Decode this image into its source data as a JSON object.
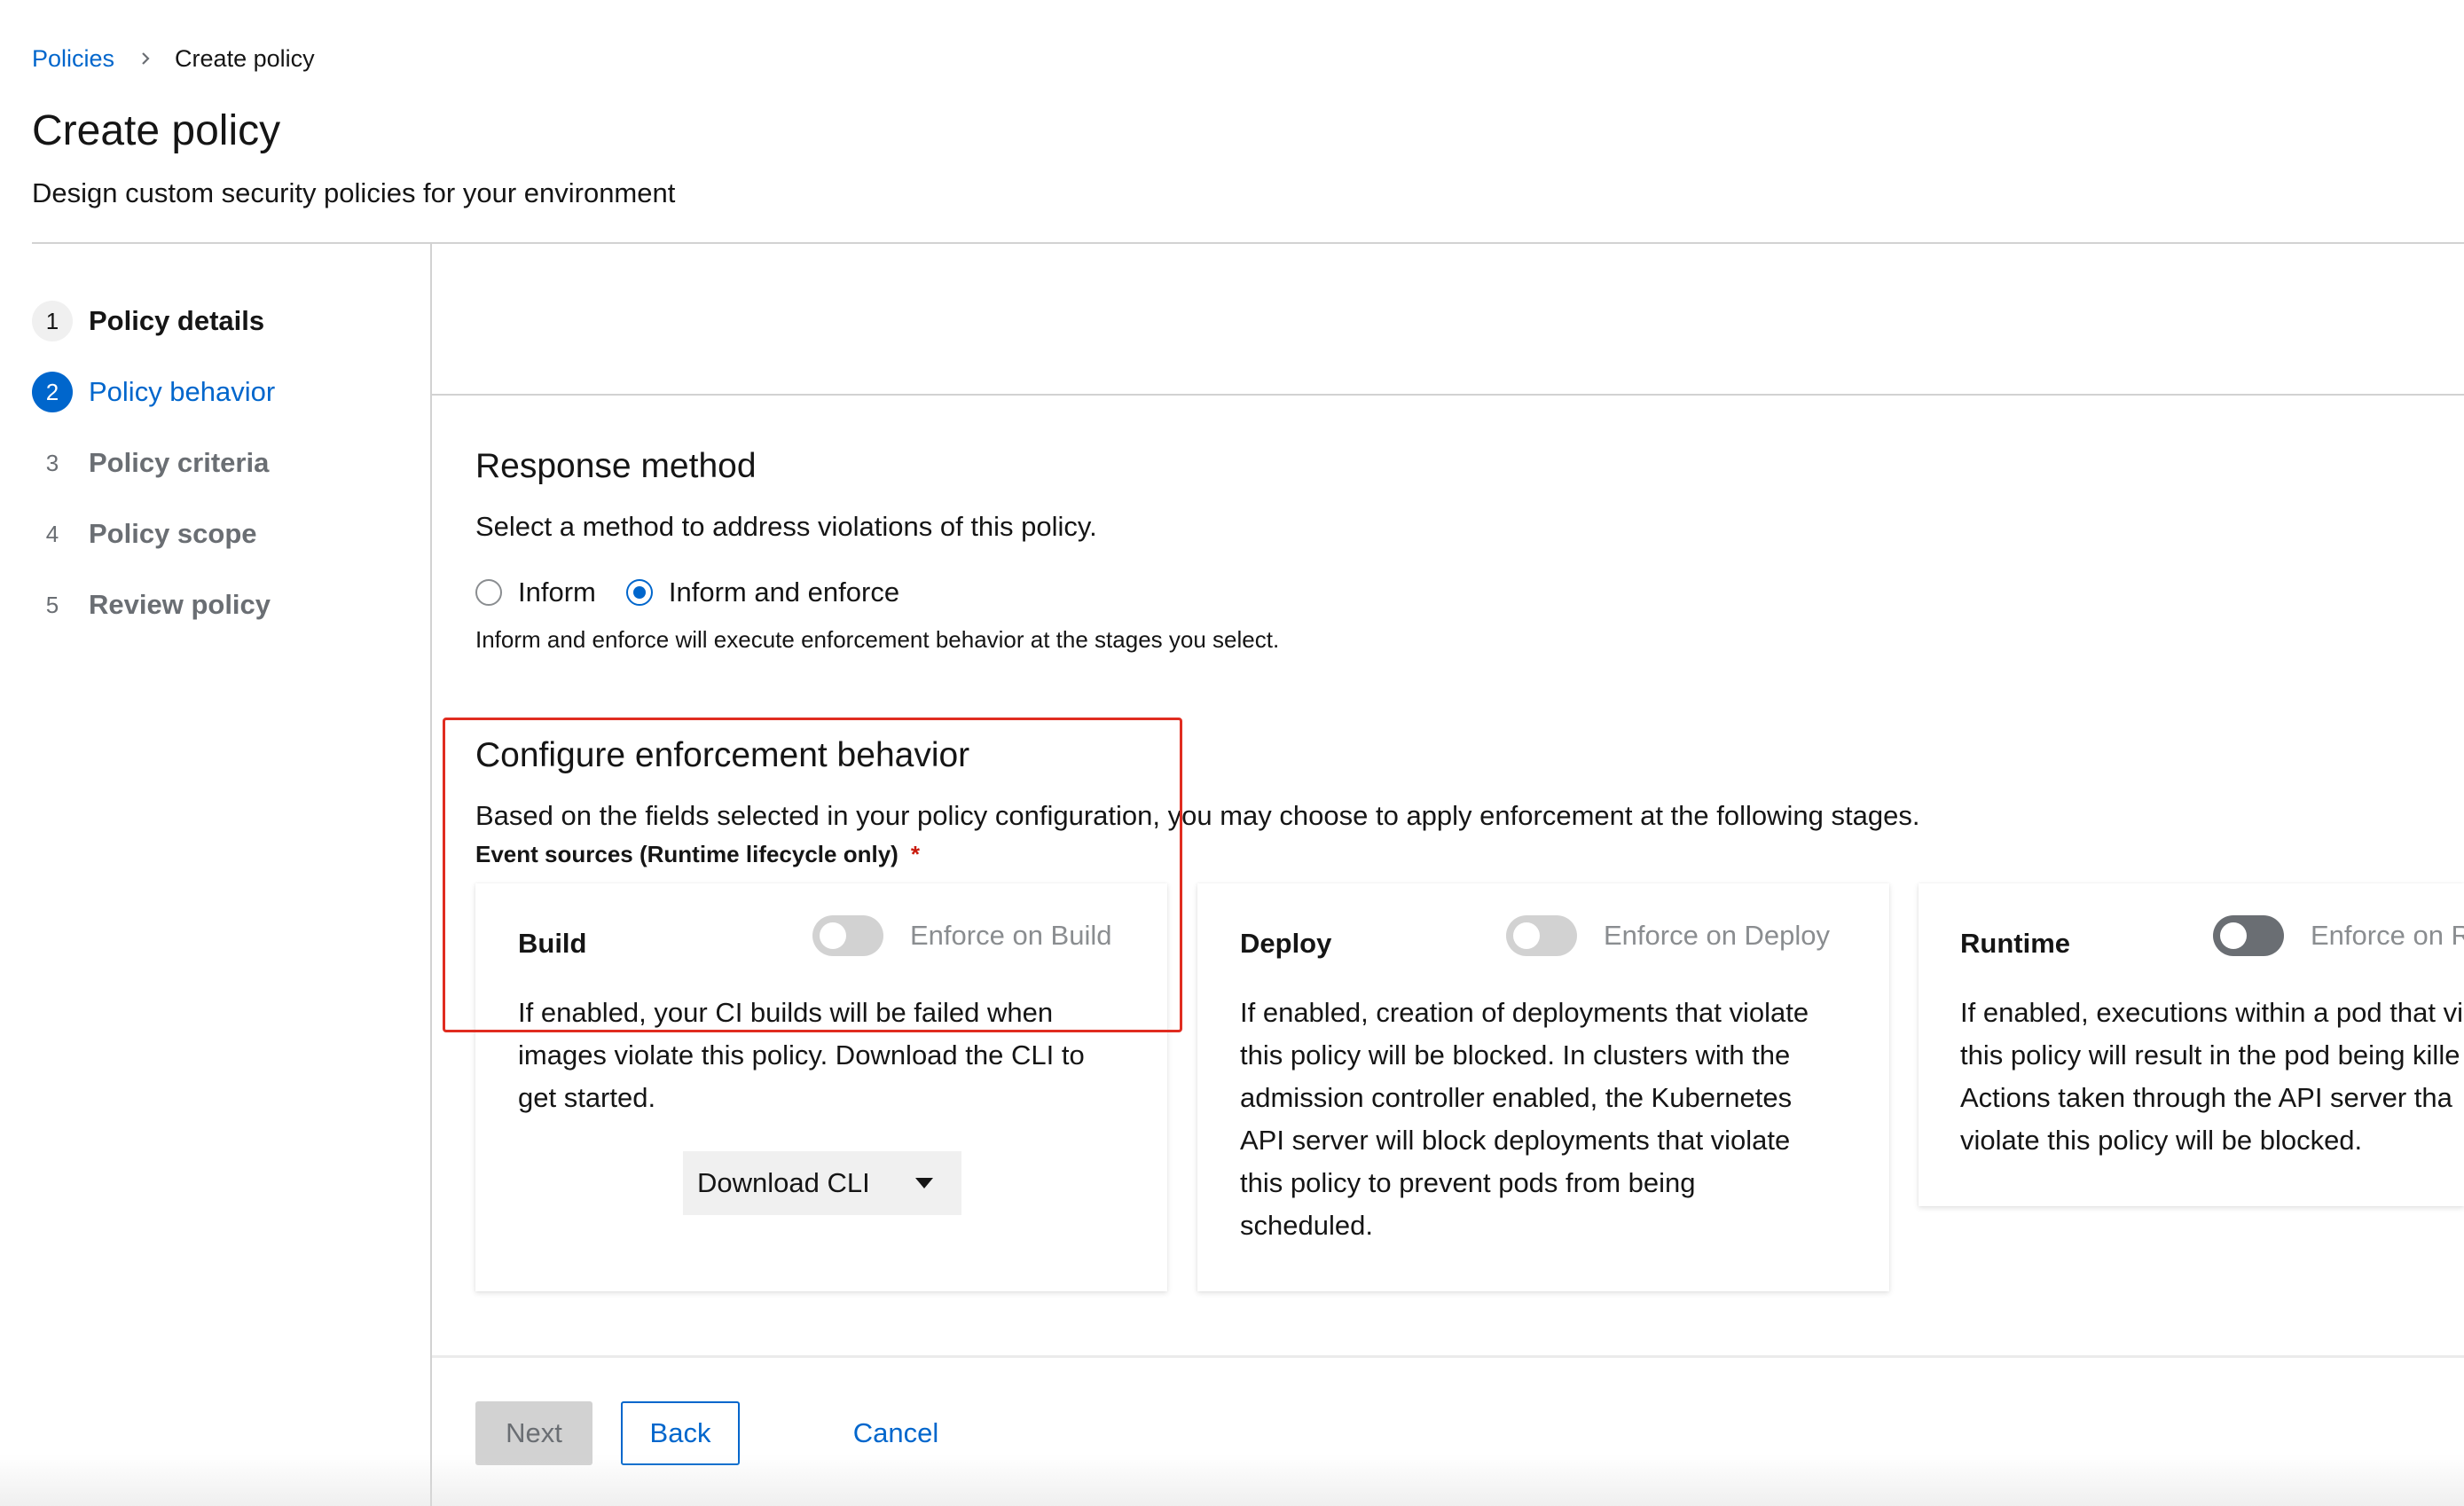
{
  "breadcrumb": {
    "parent": "Policies",
    "current": "Create policy"
  },
  "header": {
    "title": "Create policy",
    "subtitle": "Design custom security policies for your environment"
  },
  "wizard_nav": {
    "items": [
      {
        "number": "1",
        "label": "Policy details",
        "state": "done"
      },
      {
        "number": "2",
        "label": "Policy behavior",
        "state": "current"
      },
      {
        "number": "3",
        "label": "Policy criteria",
        "state": "upcoming"
      },
      {
        "number": "4",
        "label": "Policy scope",
        "state": "upcoming"
      },
      {
        "number": "5",
        "label": "Review policy",
        "state": "upcoming"
      }
    ]
  },
  "response_method": {
    "title": "Response method",
    "description": "Select a method to address violations of this policy.",
    "options": [
      {
        "label": "Inform",
        "checked": false
      },
      {
        "label": "Inform and enforce",
        "checked": true
      }
    ],
    "helper": "Inform and enforce will execute enforcement behavior at the stages you select."
  },
  "enforcement": {
    "title": "Configure enforcement behavior",
    "description": "Based on the fields selected in your policy configuration, you may choose to apply enforcement at the following stages.",
    "event_sources_label": "Event sources (Runtime lifecycle only)",
    "required_marker": "*",
    "cards": [
      {
        "title": "Build",
        "toggle_label": "Enforce on Build",
        "enabled": false,
        "lines": [
          "If enabled, your CI builds will be failed when",
          "images violate this policy. Download the CLI to",
          "get started."
        ],
        "action_label": "Download CLI"
      },
      {
        "title": "Deploy",
        "toggle_label": "Enforce on Deploy",
        "enabled": false,
        "lines": [
          "If enabled, creation of deployments that violate",
          "this policy will be blocked. In clusters with the",
          "admission controller enabled, the Kubernetes",
          "API server will block deployments that violate",
          "this policy to prevent pods from being",
          "scheduled."
        ]
      },
      {
        "title": "Runtime",
        "toggle_label": "Enforce on R",
        "enabled": false,
        "lines": [
          "If enabled, executions within a pod that vi",
          "this policy will result in the pod being kille",
          "Actions taken through the API server tha",
          "violate this policy will be blocked."
        ]
      }
    ]
  },
  "footer": {
    "next_label": "Next",
    "back_label": "Back",
    "cancel_label": "Cancel"
  },
  "colors": {
    "link": "#0066cc",
    "highlight": "#e02c20",
    "required": "#c9190b"
  }
}
